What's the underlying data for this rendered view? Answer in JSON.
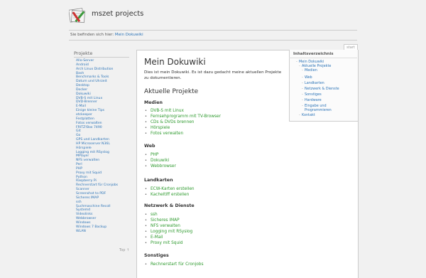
{
  "header": {
    "site_title": "mszet projects"
  },
  "breadcrumb": {
    "prefix": "Sie befinden sich hier:",
    "current": "Mein Dokuwiki"
  },
  "sidebar": {
    "title": "Projekte",
    "items": [
      "Allo-Server",
      "Android",
      "Arch Linux Distribution",
      "Bash",
      "Benchmarks & Tools",
      "Datum und Uhrzeit",
      "Desktop",
      "Docker",
      "Dokuwiki",
      "DVB-S mit Linux",
      "DVD-Brenner",
      "E-Mail",
      "Einige kleine Tips",
      "etckeeper",
      "Festplatten",
      "Fotos verwalten",
      "FRITZ!Box 7490",
      "Git",
      "Go",
      "GPS und Landkarten",
      "HP Microserver N36L",
      "Hörspiele",
      "Logging mit RSyslog",
      "MPlayer",
      "NFS verwalten",
      "Perl",
      "PHP",
      "Proxy mit Squid",
      "Python",
      "Raspberry Pi",
      "Rechnerstart für Cronjobs",
      "Scanner",
      "Screenshot to PDF",
      "Sicheres IMAP",
      "ssh",
      "Suchmaschine Recoll",
      "Systemd",
      "Videolinks",
      "Webbrowser",
      "Windows",
      "Windows 7 Backup",
      "WLAN"
    ],
    "top_link": "Top ↑"
  },
  "content": {
    "tab_label": "start",
    "title": "Mein Dokuwiki",
    "intro": "Dies ist mein Dokuwiki. Es ist dazu gedacht meine aktuellen Projekte zu dokumentieren.",
    "section_title": "Aktuelle Projekte",
    "groups": [
      {
        "title": "Medien",
        "items": [
          "DVB-S mit Linux",
          "Fernsehprogramm mit TV-Browser",
          "CDs & DVDs brennen",
          "Hörspiele",
          "Fotos verwalten"
        ]
      },
      {
        "title": "Web",
        "items": [
          "PHP",
          "Dokuwiki",
          "Webbrowser"
        ]
      },
      {
        "title": "Landkarten",
        "items": [
          "ECW-Karten erstellen",
          "Kacheltiff erstellen"
        ]
      },
      {
        "title": "Netzwerk & Dienste",
        "items": [
          "ssh",
          "Sicheres IMAP",
          "NFS verwalten",
          "Logging mit RSyslog",
          "E-Mail",
          "Proxy mit Squid"
        ]
      },
      {
        "title": "Sonstiges",
        "items": [
          "Rechnerstart für Cronjobs"
        ]
      }
    ]
  },
  "toc": {
    "title": "Inhaltsverzeichnis",
    "items": [
      "Mein Dokuwiki",
      "Aktuelle Projekte",
      "Medien",
      "Web",
      "Landkarten",
      "Netzwerk & Dienste",
      "Sonstiges",
      "Hardware",
      "Eingabe und Programmieren",
      "Kontakt"
    ]
  },
  "colors": {
    "link": "#2b73b7",
    "page_link": "#2e9a2e",
    "background": "#f1f1f1"
  }
}
